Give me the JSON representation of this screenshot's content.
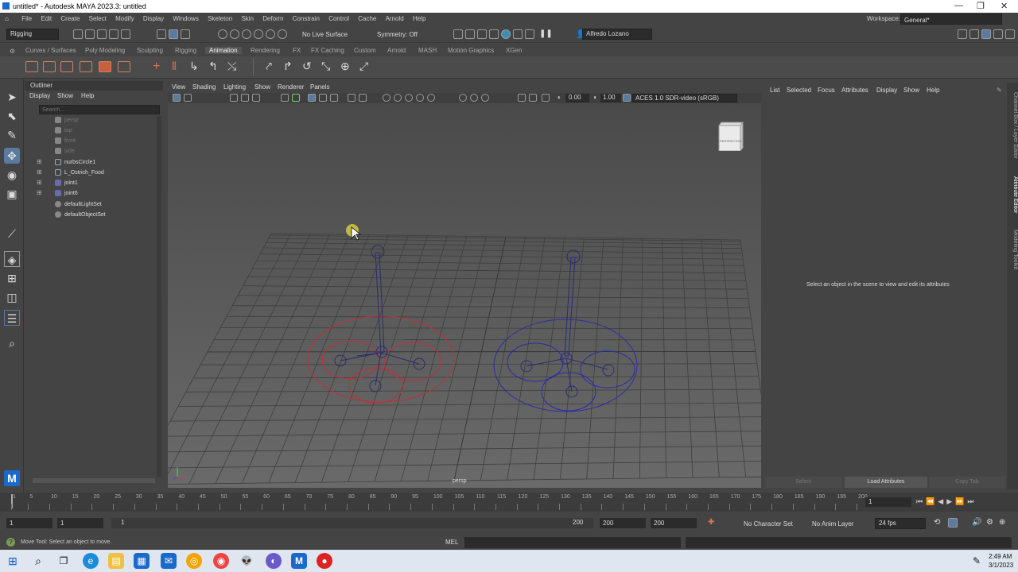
{
  "window": {
    "title": "untitled* - Autodesk MAYA 2023.3: untitled",
    "controls": [
      "—",
      "❐",
      "✕"
    ]
  },
  "menubar": {
    "items": [
      "File",
      "Edit",
      "Create",
      "Select",
      "Modify",
      "Display",
      "Windows",
      "Skeleton",
      "Skin",
      "Deform",
      "Constrain",
      "Control",
      "Cache",
      "Arnold",
      "Help"
    ],
    "workspace_label": "Workspace:",
    "workspace_value": "General*"
  },
  "statusline": {
    "mode": "Rigging",
    "live_surface": "No Live Surface",
    "symmetry": "Symmetry: Off",
    "user": "Alfredo Lozano"
  },
  "shelf": {
    "tabs": [
      "Curves / Surfaces",
      "Poly Modeling",
      "Sculpting",
      "Rigging",
      "Animation",
      "Rendering",
      "FX",
      "FX Caching",
      "Custom",
      "Arnold",
      "MASH",
      "Motion Graphics",
      "XGen"
    ],
    "active": "Animation"
  },
  "outliner": {
    "title": "Outliner",
    "menu": [
      "Display",
      "Show",
      "Help"
    ],
    "search_placeholder": "Search...",
    "items": [
      {
        "label": "persp",
        "dim": true
      },
      {
        "label": "top",
        "dim": true
      },
      {
        "label": "front",
        "dim": true
      },
      {
        "label": "side",
        "dim": true
      },
      {
        "label": "nurbsCircle1",
        "dim": false
      },
      {
        "label": "L_Ostrich_Food",
        "dim": false
      },
      {
        "label": "joint1",
        "dim": false
      },
      {
        "label": "joint6",
        "dim": false
      },
      {
        "label": "defaultLightSet",
        "dim": false
      },
      {
        "label": "defaultObjectSet",
        "dim": false
      }
    ]
  },
  "viewport": {
    "menu": [
      "View",
      "Shading",
      "Lighting",
      "Show",
      "Renderer",
      "Panels"
    ],
    "exposure": "0.00",
    "gamma": "1.00",
    "color_space": "ACES 1.0 SDR-video (sRGB)",
    "camera": "persp",
    "cube_label": "PERSPECTIVE",
    "colors": {
      "red_rig": "#c0303a",
      "blue_rig": "#2a2aa8",
      "joint": "#2c2c6e"
    }
  },
  "attribute_editor": {
    "tabs": [
      "List",
      "Selected",
      "Focus",
      "Attributes",
      "Display",
      "Show",
      "Help"
    ],
    "message": "Select an object in the scene to view and edit its attributes",
    "buttons": [
      "Select",
      "Load Attributes",
      "Copy Tab"
    ]
  },
  "side_tabs": [
    "Channel Box / Layer Editor",
    "Attribute Editor",
    "Modeling Toolkit"
  ],
  "timeline": {
    "ticks": [
      "1",
      "5",
      "10",
      "15",
      "20",
      "25",
      "30",
      "35",
      "40",
      "45",
      "50",
      "55",
      "60",
      "65",
      "70",
      "75",
      "80",
      "85",
      "90",
      "95",
      "100",
      "105",
      "110",
      "115",
      "120",
      "125",
      "130",
      "135",
      "140",
      "145",
      "150",
      "155",
      "160",
      "165",
      "170",
      "175",
      "180",
      "185",
      "190",
      "195",
      "200"
    ],
    "current_frame": "1"
  },
  "range": {
    "start": "1",
    "start2": "1",
    "slider_start": "1",
    "slider_end": "200",
    "end1": "200",
    "end2": "200",
    "character_set": "No Character Set",
    "anim_layer": "No Anim Layer",
    "fps": "24 fps"
  },
  "cmdline": {
    "help": "Move Tool: Select an object to move.",
    "lang": "MEL"
  },
  "taskbar": {
    "time": "2:49 AM",
    "date": "3/1/2023"
  }
}
